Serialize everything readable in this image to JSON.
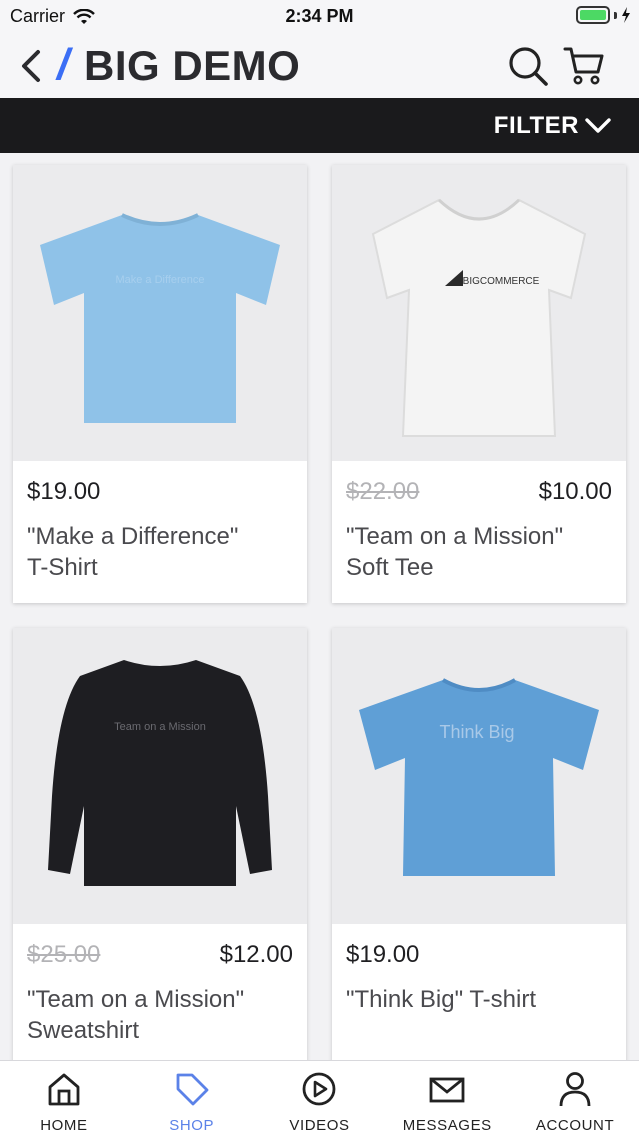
{
  "status": {
    "carrier": "Carrier",
    "time": "2:34 PM"
  },
  "header": {
    "title": "BIG DEMO",
    "slash": "/"
  },
  "filter": {
    "label": "FILTER"
  },
  "products": [
    {
      "price": "$19.00",
      "old_price": "",
      "name_line1": "\"Make a Difference\"",
      "name_line2": "T-Shirt",
      "shirt_color": "#8fc2e8",
      "print_text": "Make a Difference"
    },
    {
      "price": "$10.00",
      "old_price": "$22.00",
      "name_line1": "\"Team on a Mission\"",
      "name_line2": "Soft Tee",
      "shirt_color": "#f4f4f4",
      "print_text": "BIGCOMMERCE"
    },
    {
      "price": "$12.00",
      "old_price": "$25.00",
      "name_line1": "\"Team on a Mission\"",
      "name_line2": "Sweatshirt",
      "shirt_color": "#1e1e22",
      "print_text": "Team on a Mission"
    },
    {
      "price": "$19.00",
      "old_price": "",
      "name_line1": "\"Think Big\" T-shirt",
      "name_line2": "",
      "shirt_color": "#5f9fd6",
      "print_text": "Think Big"
    }
  ],
  "tabs": [
    {
      "label": "HOME",
      "icon": "home-icon",
      "active": false
    },
    {
      "label": "SHOP",
      "icon": "tag-icon",
      "active": true
    },
    {
      "label": "VIDEOS",
      "icon": "play-icon",
      "active": false
    },
    {
      "label": "MESSAGES",
      "icon": "mail-icon",
      "active": false
    },
    {
      "label": "ACCOUNT",
      "icon": "user-icon",
      "active": false
    }
  ],
  "colors": {
    "accent": "#3b6ef5",
    "tab_active": "#5b82e8",
    "filter_bar": "#1a1a1c",
    "battery": "#4cd964"
  }
}
